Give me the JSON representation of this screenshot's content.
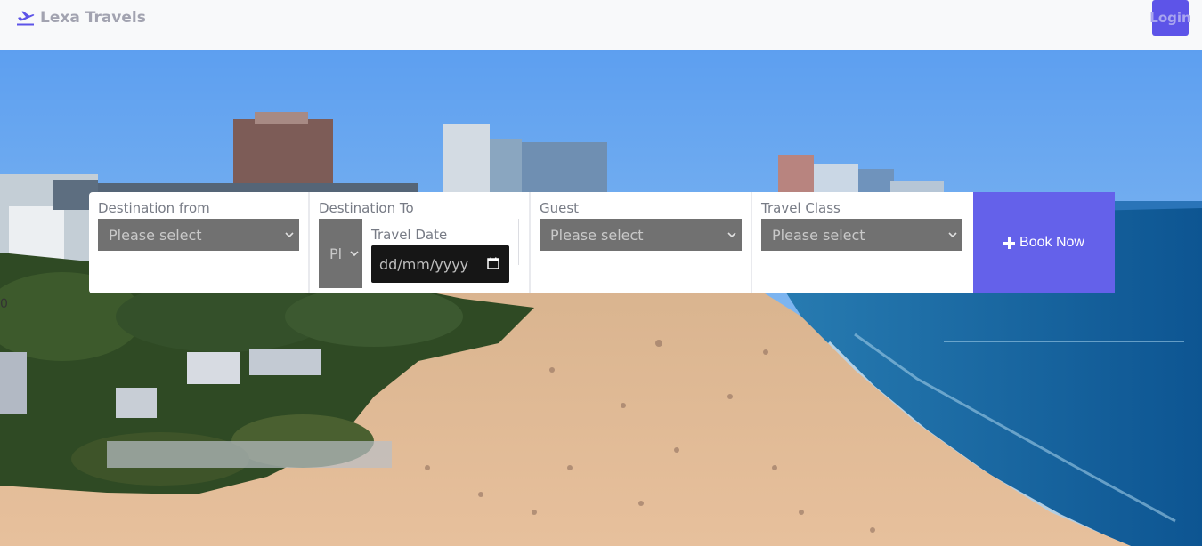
{
  "navbar": {
    "brand": "Lexa Travels",
    "brand_icon": "plane-departure-icon",
    "login_label": "Login"
  },
  "hero": {
    "stray_text": "0"
  },
  "booking": {
    "destination_from": {
      "label": "Destination from",
      "value": "Please select"
    },
    "destination_to": {
      "label": "Destination To",
      "value": "Pl"
    },
    "travel_date": {
      "label": "Travel Date",
      "placeholder": "dd/mm/yyyy"
    },
    "guest": {
      "label": "Guest",
      "value": "Please select"
    },
    "travel_class": {
      "label": "Travel Class",
      "value": "Please select"
    },
    "book_label": "Book Now",
    "book_icon": "plus-icon"
  },
  "colors": {
    "navbar_bg": "#f8f9fa",
    "brand_text": "#a2a3b0",
    "accent": "#6461ea",
    "select_bg": "#717171",
    "date_bg": "#161616"
  }
}
